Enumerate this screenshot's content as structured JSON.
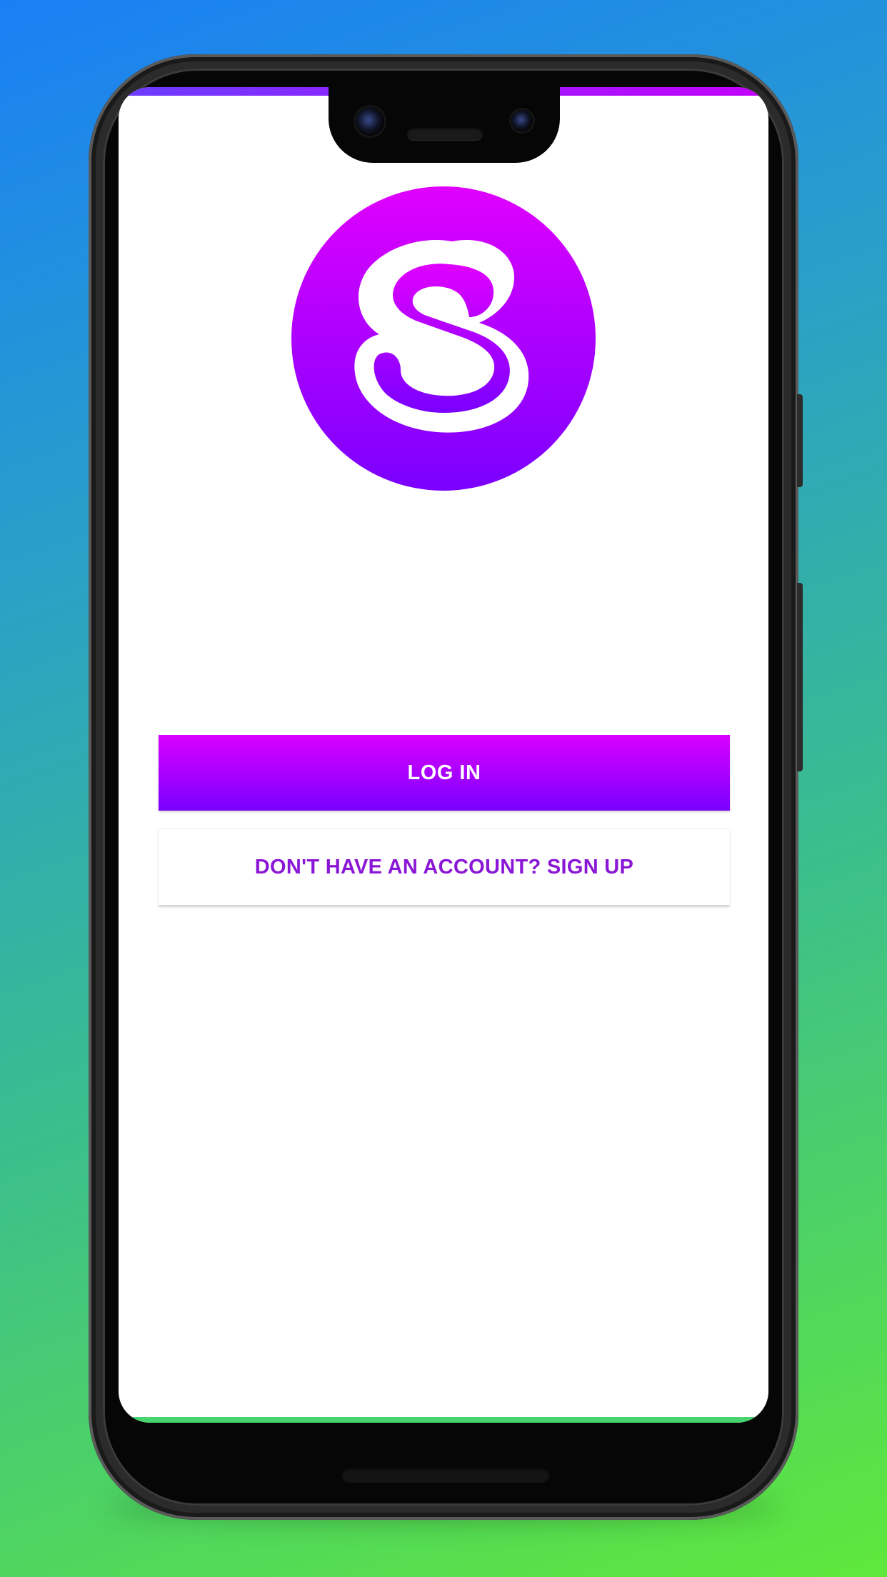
{
  "colors": {
    "brand_gradient_top": "#d900ff",
    "brand_gradient_bottom": "#7a00ff",
    "link_text": "#8a16d6",
    "screen_background": "#ffffff"
  },
  "logo": {
    "icon": "s-logo-icon",
    "letter": "S"
  },
  "auth": {
    "login_label": "LOG IN",
    "signup_label": "DON'T HAVE AN ACCOUNT? SIGN UP"
  }
}
